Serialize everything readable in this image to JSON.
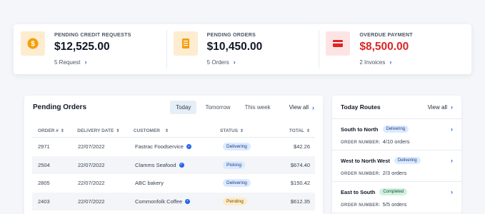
{
  "summary": [
    {
      "label": "PENDING CREDIT REQUESTS",
      "value": "$12,525.00",
      "link": "5 Request",
      "icon": "dollar-coin-icon",
      "icon_bg": "#fdeccf",
      "icon_color": "#f59e0b",
      "value_color": "#111827"
    },
    {
      "label": "PENDING ORDERS",
      "value": "$10,450.00",
      "link": "5 Orders",
      "icon": "document-icon",
      "icon_bg": "#fdeccf",
      "icon_color": "#f59e0b",
      "value_color": "#111827"
    },
    {
      "label": "OVERDUE PAYMENT",
      "value": "$8,500.00",
      "link": "2 Invoices",
      "icon": "credit-card-icon",
      "icon_bg": "#fde4e4",
      "icon_color": "#dc2626",
      "value_color": "#dc2626"
    }
  ],
  "orders": {
    "title": "Pending Orders",
    "tabs": [
      "Today",
      "Tomorrow",
      "This week"
    ],
    "active_tab": "Today",
    "view_all": "View all",
    "columns": [
      "ORDER #",
      "DELIVERY DATE",
      "CUSTOMER",
      "STATUS",
      "TOTAL"
    ],
    "rows": [
      {
        "order": "2971",
        "date": "22/07/2022",
        "customer": "Fastrac Foodservice",
        "status": "Delivering",
        "total": "$42.26"
      },
      {
        "order": "2504",
        "date": "22/07/2022",
        "customer": "Clamms Seafood",
        "status": "Picking",
        "total": "$674.40"
      },
      {
        "order": "2805",
        "date": "22/07/2022",
        "customer": "ABC bakery",
        "status": "Delivering",
        "total": "$150.42"
      },
      {
        "order": "2403",
        "date": "22/07/2022",
        "customer": "Commonfolk Coffee",
        "status": "Pending",
        "total": "$612.35"
      }
    ]
  },
  "routes": {
    "title": "Today Routes",
    "view_all": "View all",
    "meta_label": "ORDER NUMBER:",
    "items": [
      {
        "name": "South to North",
        "status": "Delivering",
        "orders": "4/10 orders"
      },
      {
        "name": "West to North West",
        "status": "Delivering",
        "orders": "2/3 orders"
      },
      {
        "name": "East to South",
        "status": "Completed",
        "orders": "5/5 orders"
      }
    ]
  }
}
